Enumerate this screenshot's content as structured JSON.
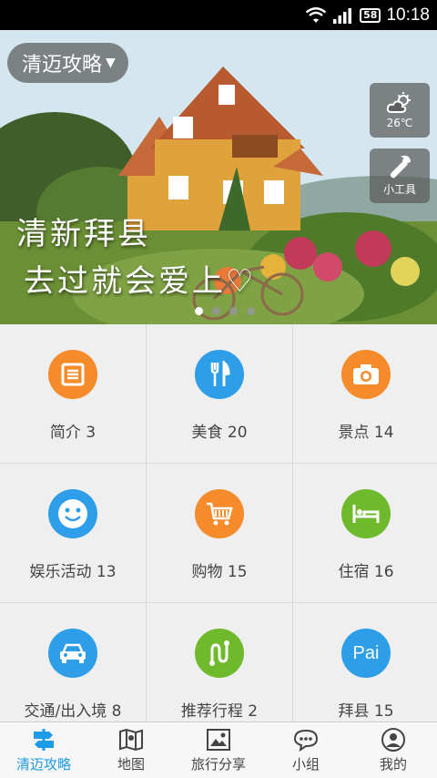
{
  "status_bar": {
    "battery": "58",
    "time": "10:18"
  },
  "banner": {
    "city_selector": "清迈攻略",
    "weather": {
      "temp": "26℃",
      "icon": "partly-cloudy-icon"
    },
    "tools_label": "小工具",
    "headline_line1": "清新拜县",
    "headline_line2": "去过就会爱上♡",
    "slides": 4,
    "active_slide": 0
  },
  "categories": [
    {
      "label": "简介 3",
      "icon": "document-icon",
      "color": "#f68b2c"
    },
    {
      "label": "美食 20",
      "icon": "fork-knife-icon",
      "color": "#2e9ee8"
    },
    {
      "label": "景点 14",
      "icon": "camera-icon",
      "color": "#f68b2c"
    },
    {
      "label": "娱乐活动 13",
      "icon": "smiley-icon",
      "color": "#2e9ee8"
    },
    {
      "label": "购物 15",
      "icon": "shopping-cart-icon",
      "color": "#f68b2c"
    },
    {
      "label": "住宿 16",
      "icon": "bed-icon",
      "color": "#6fb92c"
    },
    {
      "label": "交通/出入境 8",
      "icon": "car-icon",
      "color": "#2e9ee8"
    },
    {
      "label": "推荐行程 2",
      "icon": "route-icon",
      "color": "#6fb92c"
    },
    {
      "label": "拜县 15",
      "icon": "pai-icon",
      "icon_text": "Pai",
      "color": "#2e9ee8"
    }
  ],
  "bottom_nav": [
    {
      "label": "清迈攻略",
      "icon": "signpost-icon",
      "active": true
    },
    {
      "label": "地图",
      "icon": "map-icon",
      "active": false
    },
    {
      "label": "旅行分享",
      "icon": "picture-icon",
      "active": false
    },
    {
      "label": "小组",
      "icon": "chat-icon",
      "active": false
    },
    {
      "label": "我的",
      "icon": "profile-icon",
      "active": false
    }
  ],
  "colors": {
    "accent": "#1e9be6",
    "orange": "#f68b2c",
    "green": "#6fb92c",
    "blue": "#2e9ee8"
  }
}
